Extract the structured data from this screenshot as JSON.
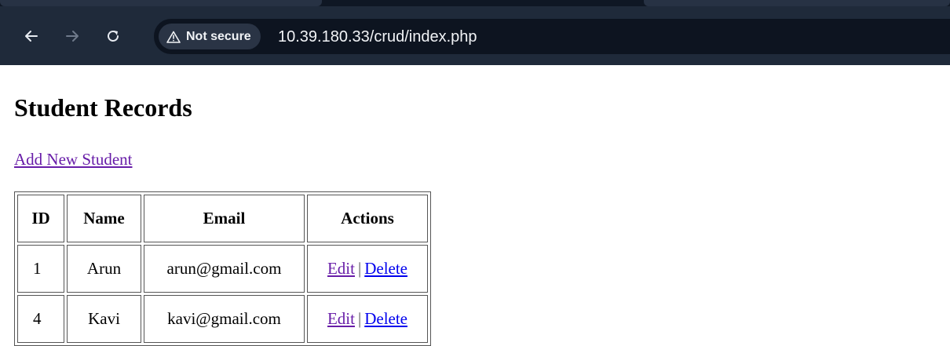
{
  "browser": {
    "security_label": "Not secure",
    "url": "10.39.180.33/crud/index.php",
    "icons": {
      "back": "back-arrow-icon",
      "forward": "forward-arrow-icon",
      "reload": "reload-icon",
      "warning": "warning-icon"
    }
  },
  "page": {
    "title": "Student Records",
    "add_link": "Add New Student",
    "colors": {
      "visited_link": "#681da8",
      "link": "#0000ee"
    }
  },
  "table": {
    "headers": {
      "id": "ID",
      "name": "Name",
      "email": "Email",
      "actions": "Actions"
    },
    "rows": [
      {
        "id": "1",
        "name": "Arun",
        "email": "arun@gmail.com",
        "edit": "Edit",
        "separator": "|",
        "delete": "Delete"
      },
      {
        "id": "4",
        "name": "Kavi",
        "email": "kavi@gmail.com",
        "edit": "Edit",
        "separator": "|",
        "delete": "Delete"
      }
    ]
  }
}
